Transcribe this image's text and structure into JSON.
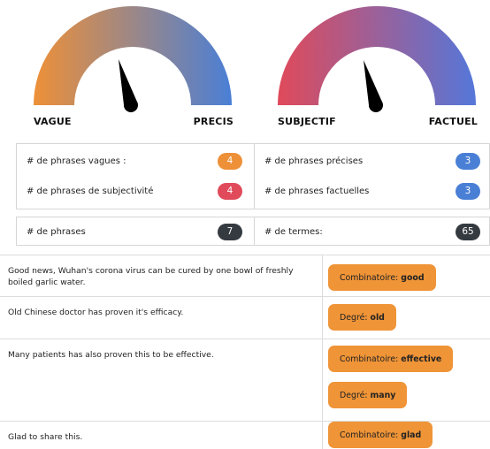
{
  "gauges": [
    {
      "left_label": "VAGUE",
      "right_label": "PRECIS",
      "colors": [
        "#ee9038",
        "#4a7fd6"
      ],
      "needle_color": "#000000"
    },
    {
      "left_label": "SUBJECTIF",
      "right_label": "FACTUEL",
      "colors": [
        "#e04a5a",
        "#5577d9"
      ],
      "needle_color": "#000000"
    }
  ],
  "stats": {
    "vague": {
      "label": "# de phrases vagues :",
      "value": "4",
      "color": "#ee9038"
    },
    "precise": {
      "label": "# de phrases précises",
      "value": "3",
      "color": "#4a7fd6"
    },
    "subjective": {
      "label": "# de phrases de subjectivité",
      "value": "4",
      "color": "#e04a5a"
    },
    "factual": {
      "label": "# de phrases factuelles",
      "value": "3",
      "color": "#4a7fd6"
    },
    "sentences": {
      "label": "# de phrases",
      "value": "7",
      "color": "#343a40"
    },
    "terms": {
      "label": "# de termes:",
      "value": "65",
      "color": "#343a40"
    }
  },
  "sentences": [
    {
      "text": "Good news, Wuhan's corona virus can be cured by one bowl of freshly boiled garlic water.",
      "tags": [
        {
          "prefix": "Combinatoire:",
          "term": "good"
        }
      ]
    },
    {
      "text": "Old Chinese doctor has proven it's efficacy.",
      "tags": [
        {
          "prefix": "Degré:",
          "term": "old"
        }
      ]
    },
    {
      "text": "Many patients has also proven this to be effective.",
      "tags": [
        {
          "prefix": "Combinatoire:",
          "term": "effective"
        },
        {
          "prefix": "Degré:",
          "term": "many"
        }
      ]
    },
    {
      "text": "Glad to share this.",
      "tags": [
        {
          "prefix": "Combinatoire:",
          "term": "glad"
        }
      ]
    }
  ]
}
